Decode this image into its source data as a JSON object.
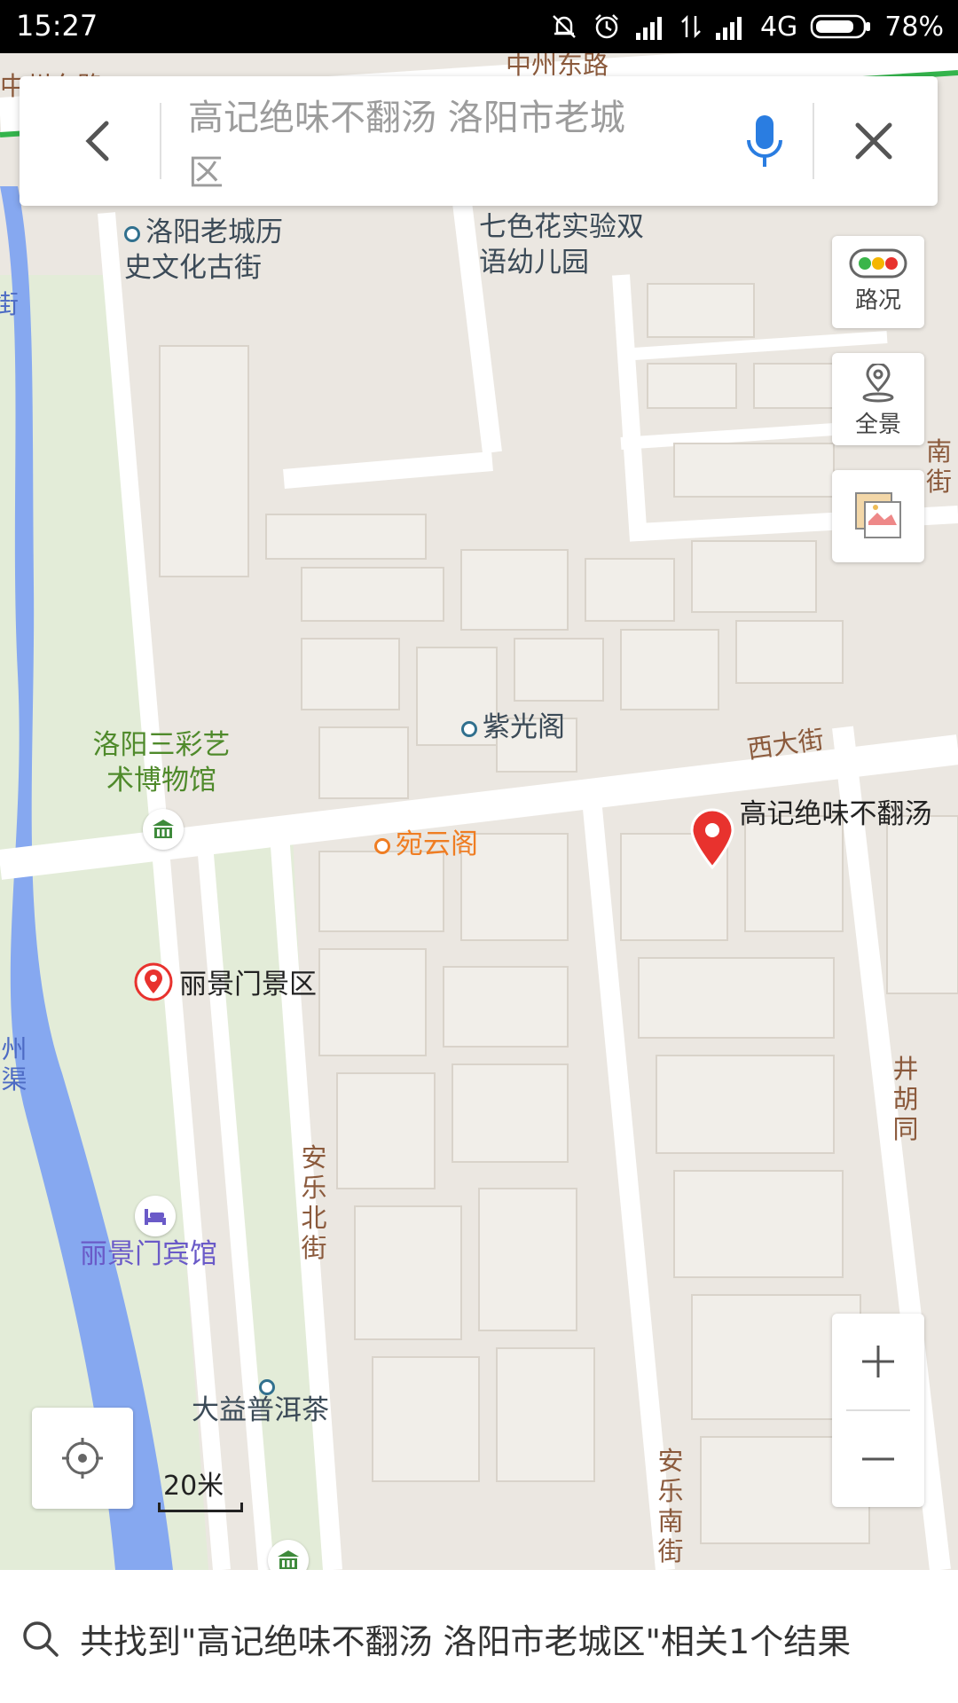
{
  "status_bar": {
    "time": "15:27",
    "network": "4G",
    "battery": "78%"
  },
  "search": {
    "query": "高记绝味不翻汤 洛阳市老城区"
  },
  "tools": {
    "traffic_label": "路况",
    "panorama_label": "全景"
  },
  "map": {
    "pois": {
      "old_street": "洛阳老城历史文化古街",
      "kindergarten": "七色花实验双语幼儿园",
      "ziguang": "紫光阁",
      "museum": "洛阳三彩艺术博物馆",
      "wanyun": "宛云阁",
      "target": "高记绝味不翻汤",
      "lijingmen_scenic": "丽景门景区",
      "hotel": "丽景门宾馆",
      "tea": "大益普洱茶"
    },
    "streets": {
      "zhongzhou_top": "中州东路",
      "zhongzhou_left": "中州东路",
      "xida": "西大街",
      "anle_bei": "安乐北街",
      "anle_nan": "安乐南街",
      "jinghu": "井胡同",
      "zhouqu": "州渠",
      "right_edge_nan": "南",
      "right_edge_jie": "街",
      "left_edge": "街"
    },
    "scale_label": "20米"
  },
  "result": {
    "text": "共找到\"高记绝味不翻汤 洛阳市老城区\"相关1个结果"
  },
  "colors": {
    "road": "#ffffff",
    "block": "#ebe7e1",
    "green": "#dfe9d3",
    "water": "#83a6f2",
    "pin": "#e8322e",
    "mic": "#2a7de1",
    "brand_road": "#33b34a"
  }
}
